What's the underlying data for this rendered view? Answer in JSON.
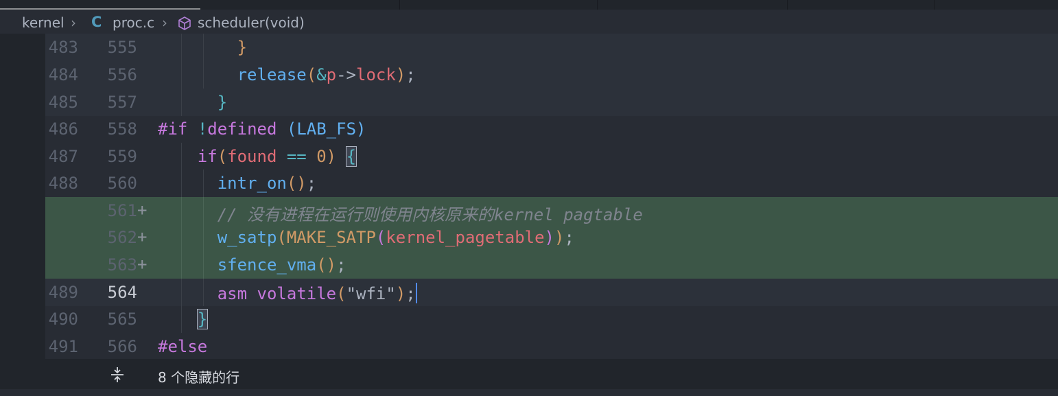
{
  "breadcrumb": {
    "folder": "kernel",
    "file_icon": "C",
    "file": "proc.c",
    "symbol_icon": "cube-icon",
    "symbol": "scheduler(void)"
  },
  "lines": [
    {
      "old": "483",
      "new": "555",
      "added": false,
      "code": "}"
    },
    {
      "old": "484",
      "new": "556",
      "added": false,
      "code": "release(&p->lock);"
    },
    {
      "old": "485",
      "new": "557",
      "added": false,
      "code": "}"
    },
    {
      "old": "486",
      "new": "558",
      "added": false,
      "code": "#if !defined (LAB_FS)"
    },
    {
      "old": "487",
      "new": "559",
      "added": false,
      "code": "if(found == 0) {"
    },
    {
      "old": "488",
      "new": "560",
      "added": false,
      "code": "intr_on();"
    },
    {
      "old": "",
      "new": "561",
      "added": true,
      "code": "// 没有进程在运行则使用内核原来的kernel pagtable"
    },
    {
      "old": "",
      "new": "562",
      "added": true,
      "code": "w_satp(MAKE_SATP(kernel_pagetable));"
    },
    {
      "old": "",
      "new": "563",
      "added": true,
      "code": "sfence_vma();"
    },
    {
      "old": "489",
      "new": "564",
      "added": false,
      "current": true,
      "code": "asm volatile(\"wfi\");"
    },
    {
      "old": "490",
      "new": "565",
      "added": false,
      "code": "}"
    },
    {
      "old": "491",
      "new": "566",
      "added": false,
      "code": "#else"
    }
  ],
  "added_marker": "+",
  "hidden_lines": {
    "icon": "unfold-icon",
    "label": "8 个隐藏的行"
  },
  "colors": {
    "background": "#282c34",
    "added_line": "#3c5647",
    "cursor": "#528bff"
  }
}
